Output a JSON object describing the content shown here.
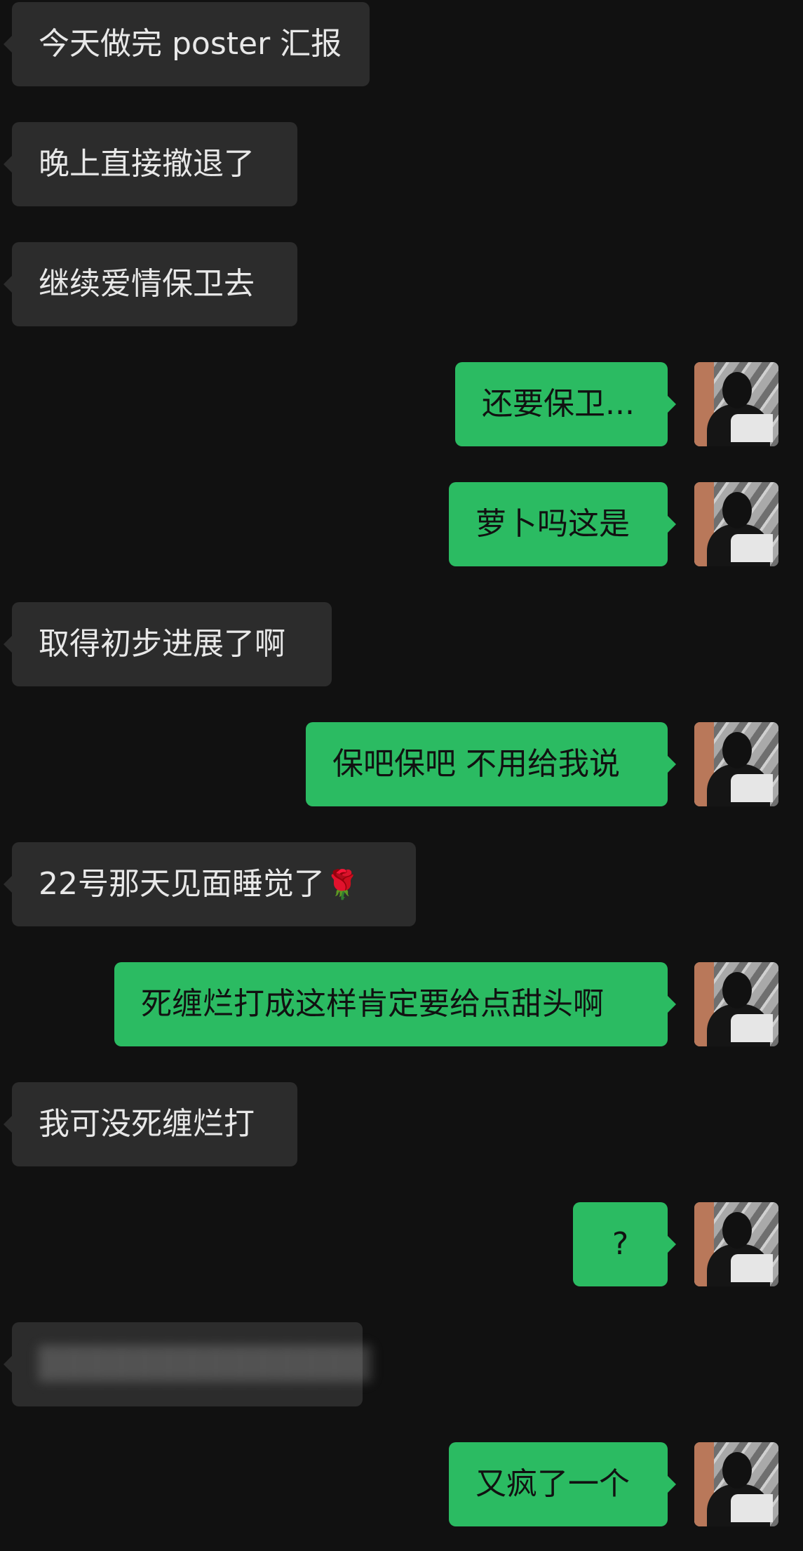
{
  "messages": [
    {
      "side": "left",
      "text": "今天做完 poster 汇报"
    },
    {
      "side": "left",
      "text": "晚上直接撤退了"
    },
    {
      "side": "left",
      "text": "继续爱情保卫去"
    },
    {
      "side": "right",
      "text": "还要保卫..."
    },
    {
      "side": "right",
      "text": "萝卜吗这是"
    },
    {
      "side": "left",
      "text": "取得初步进展了啊"
    },
    {
      "side": "right",
      "text": "保吧保吧 不用给我说"
    },
    {
      "side": "left",
      "text": "22号那天见面睡觉了",
      "emoji": "🌹"
    },
    {
      "side": "right",
      "text": "死缠烂打成这样肯定要给点甜头啊"
    },
    {
      "side": "left",
      "text": "我可没死缠烂打"
    },
    {
      "side": "right",
      "text": "?"
    },
    {
      "side": "left",
      "text": "",
      "blurred": true
    },
    {
      "side": "right",
      "text": "又疯了一个"
    }
  ],
  "colors": {
    "background": "#111111",
    "incoming_bubble": "#2c2c2c",
    "outgoing_bubble": "#2bbb62"
  },
  "icons": {
    "avatar": "user-avatar-photo"
  }
}
